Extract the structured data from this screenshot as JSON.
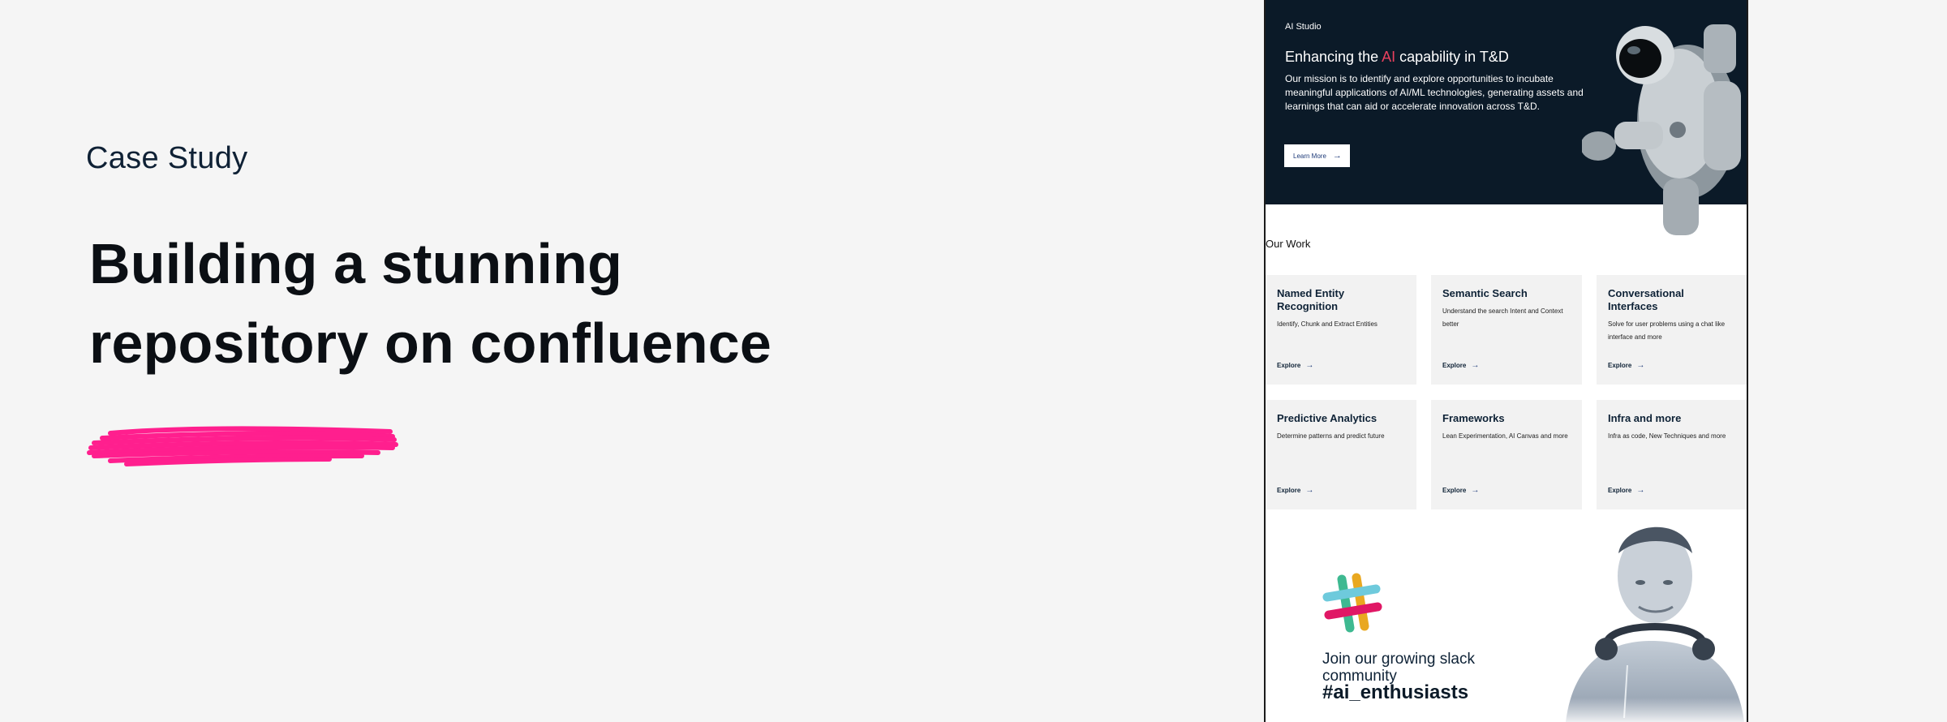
{
  "case_study": {
    "label": "Case Study",
    "title_line1": "Building a stunning",
    "title_line2": "repository on confluence",
    "accent_color": "#ff1f8e"
  },
  "preview": {
    "hero": {
      "brand": "AI Studio",
      "heading_prefix": "Enhancing the ",
      "heading_accent": "AI",
      "heading_suffix": " capability in T&D",
      "description": "Our mission is to identify and explore opportunities to incubate meaningful applications of AI/ML technologies, generating assets and learnings that can aid or accelerate innovation across T&D.",
      "button_label": "Learn More",
      "button_icon": "arrow-right-icon",
      "background": "#0b1a28",
      "accent": "#e8405e"
    },
    "section_title": "Our Work",
    "cards": [
      {
        "title": "Named Entity Recognition",
        "description": "Identify, Chunk and Extract Entities",
        "link": "Explore"
      },
      {
        "title": "Semantic Search",
        "description": "Understand the search Intent and Context better",
        "link": "Explore"
      },
      {
        "title": "Conversational Interfaces",
        "description": "Solve for user problems using a chat like interface and more",
        "link": "Explore"
      },
      {
        "title": "Predictive Analytics",
        "description": "Determine patterns and predict future",
        "link": "Explore"
      },
      {
        "title": "Frameworks",
        "description": "Lean Experimentation, AI Canvas and more",
        "link": "Explore"
      },
      {
        "title": "Infra and more",
        "description": "Infra as code, New Techniques and more",
        "link": "Explore"
      }
    ],
    "community": {
      "join_text": "Join our growing slack community",
      "hashtag": "#ai_enthusiasts",
      "logo": "slack-logo"
    }
  }
}
